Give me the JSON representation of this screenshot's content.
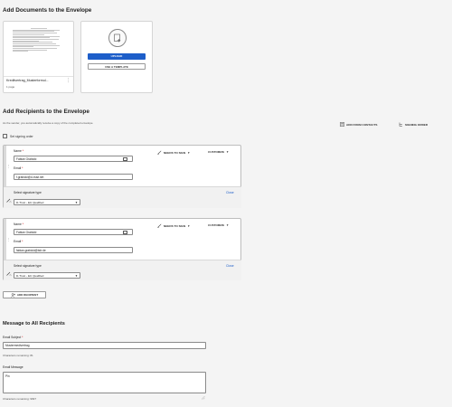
{
  "documents": {
    "heading": "Add Documents to the Envelope",
    "doc_name": "Kreditvertrag_Musterformul...",
    "doc_pages": "1 page",
    "upload_label": "UPLOAD",
    "template_label": "USE A TEMPLATE"
  },
  "recipients": {
    "heading": "Add Recipients to the Envelope",
    "note": "As the sender, you automatically receive a copy of the completed envelope.",
    "add_from_contacts": "ADD FROM CONTACTS",
    "signing_order": "SIGNING ORDER",
    "set_signing_order": "Set signing order",
    "add_recipient": "ADD RECIPIENT",
    "list": [
      {
        "number": "1",
        "name_label": "Name",
        "name_value": "Fabian Grabicki",
        "email_label": "Email",
        "email_value": "f.grabicki@d-trust.net",
        "action": "NEEDS TO SIGN",
        "customize": "CUSTOMIZE",
        "sig_label": "Select signature type",
        "sig_value": "D-Trust - EU Qualified",
        "close": "Close"
      },
      {
        "number": "2",
        "name_label": "Name",
        "name_value": "Fabian Grabicki",
        "email_label": "Email",
        "email_value": "fabian.grabicki@bdr.de",
        "action": "NEEDS TO SIGN",
        "customize": "CUSTOMIZE",
        "sig_label": "Select signature type",
        "sig_value": "D-Trust - EU Qualified",
        "close": "Close"
      }
    ]
  },
  "message": {
    "heading": "Message to All Recipients",
    "subject_label": "Email Subject",
    "subject_value": "Mustermedivertrag",
    "subject_remaining": "Characters remaining: 81",
    "message_label": "Email Message",
    "message_value": "Pin",
    "message_remaining": "Characters remaining: 9997"
  },
  "colors": {
    "accent": "#1d5ec9",
    "required": "#cc0000"
  }
}
